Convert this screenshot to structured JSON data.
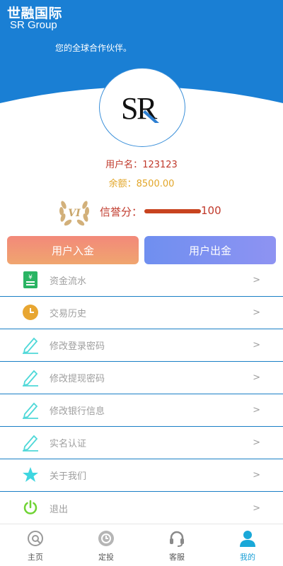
{
  "header": {
    "brand_cn": "世融国际",
    "brand_en": "SR Group",
    "slogan": "您的全球合作伙伴。",
    "logo_text": "SR",
    "bg_color": "#1a7fd4"
  },
  "profile": {
    "username_label": "用户名：",
    "username": "123123",
    "balance_label": "余额：",
    "balance": "8500.00",
    "vip_level": "VI",
    "credit_label": "信誉分：",
    "credit_value": "100",
    "credit_fraction": 1.0
  },
  "actions": {
    "deposit": "用户入金",
    "withdraw": "用户出金"
  },
  "menu": [
    {
      "label": "资金流水",
      "icon": "ledger-icon",
      "arrow": ">"
    },
    {
      "label": "交易历史",
      "icon": "clock-icon",
      "arrow": ">"
    },
    {
      "label": "修改登录密码",
      "icon": "pencil-icon",
      "arrow": ">"
    },
    {
      "label": "修改提现密码",
      "icon": "pencil-icon",
      "arrow": ">"
    },
    {
      "label": "修改银行信息",
      "icon": "pencil-icon",
      "arrow": ">"
    },
    {
      "label": "实名认证",
      "icon": "pencil-icon",
      "arrow": ">"
    },
    {
      "label": "关于我们",
      "icon": "star-icon",
      "arrow": ">"
    },
    {
      "label": "退出",
      "icon": "power-icon",
      "arrow": ">"
    }
  ],
  "nav": [
    {
      "label": "主页",
      "icon": "home-icon",
      "active": false
    },
    {
      "label": "定投",
      "icon": "invest-icon",
      "active": false
    },
    {
      "label": "客服",
      "icon": "headset-icon",
      "active": false
    },
    {
      "label": "我的",
      "icon": "user-icon",
      "active": true
    }
  ],
  "colors": {
    "accent": "#1a7fd4",
    "active_nav": "#1a9fd6",
    "credit_red": "#c0392b",
    "balance_gold": "#e2a629"
  }
}
